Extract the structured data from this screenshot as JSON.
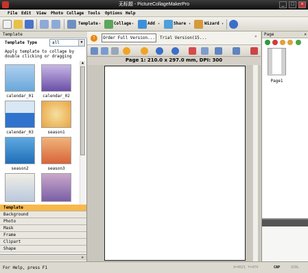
{
  "window": {
    "title": "无标题 - PictureCollageMakerPro",
    "controls": [
      "_",
      "□",
      "×"
    ]
  },
  "menu": [
    "File",
    "Edit",
    "View",
    "Photo",
    "Collage",
    "Tools",
    "Options",
    "Help"
  ],
  "toolbar": {
    "template": "Template",
    "collage": "Collage",
    "add": "Add",
    "share": "Share",
    "wizard": "Wizard",
    "caret": "▾"
  },
  "left_panel": {
    "header": "Template",
    "type_label": "Template Type",
    "type_value": "all",
    "hint": "Apply template to collage by double clicking or dragging",
    "thumbs": [
      {
        "caption": "calendar_01"
      },
      {
        "caption": "calendar_02"
      },
      {
        "caption": "calendar_03"
      },
      {
        "caption": "season1"
      },
      {
        "caption": "season2"
      },
      {
        "caption": "season3"
      },
      {
        "caption": ""
      },
      {
        "caption": ""
      }
    ],
    "categories": [
      "Template",
      "Background",
      "Photo",
      "Mask",
      "Frame",
      "Clipart",
      "Shape"
    ],
    "footer": "»"
  },
  "banner": {
    "info": "!",
    "order_label": "Order Full Version...",
    "trial_text": "Trial Version(15...",
    "close": "×"
  },
  "page_info": "Page 1: 210.0 x 297.0 mm, DPI: 300",
  "right_panel": {
    "header": "Page",
    "close": "×",
    "page_caption": "Page1"
  },
  "status": {
    "help": "For Help, press F1",
    "coords": "X=4021 Y=474",
    "cap": "CAP",
    "num": "NUM",
    "scrl": "SCRL"
  },
  "colors": {
    "accent": "#f8b84a",
    "title": "#101010"
  }
}
